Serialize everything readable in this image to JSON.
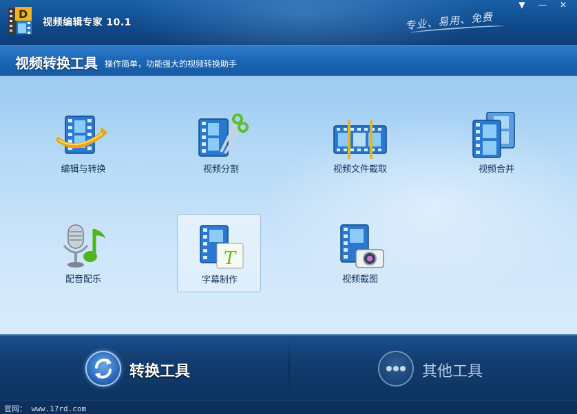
{
  "window": {
    "title": "视频编辑专家 10.1",
    "slogan": "专业、易用、免费",
    "controls": {
      "menu": "▼",
      "minimize": "—",
      "close": "✕"
    }
  },
  "section": {
    "title": "视频转换工具",
    "subtitle": "操作简单，功能强大的视频转换助手"
  },
  "tools": [
    {
      "id": "edit-convert",
      "label": "编辑与转换",
      "icon": "film-arc-icon"
    },
    {
      "id": "split",
      "label": "视频分割",
      "icon": "film-scissors-icon"
    },
    {
      "id": "trim",
      "label": "视频文件截取",
      "icon": "film-trim-icon"
    },
    {
      "id": "merge",
      "label": "视频合并",
      "icon": "film-merge-icon"
    },
    {
      "id": "dub-music",
      "label": "配音配乐",
      "icon": "microphone-music-icon"
    },
    {
      "id": "subtitle",
      "label": "字幕制作",
      "icon": "film-subtitle-icon",
      "selected": true
    },
    {
      "id": "screenshot",
      "label": "视频截图",
      "icon": "film-camera-icon"
    }
  ],
  "nav": {
    "convert_label": "转换工具",
    "other_label": "其他工具",
    "active": "convert"
  },
  "status": {
    "site": "官网： www.17rd.com"
  },
  "colors": {
    "titlebar": "#0f4a8c",
    "header": "#1b66b5",
    "content": "#b8dbf7",
    "nav": "#123d70",
    "film_blue": "#2a78d0"
  }
}
